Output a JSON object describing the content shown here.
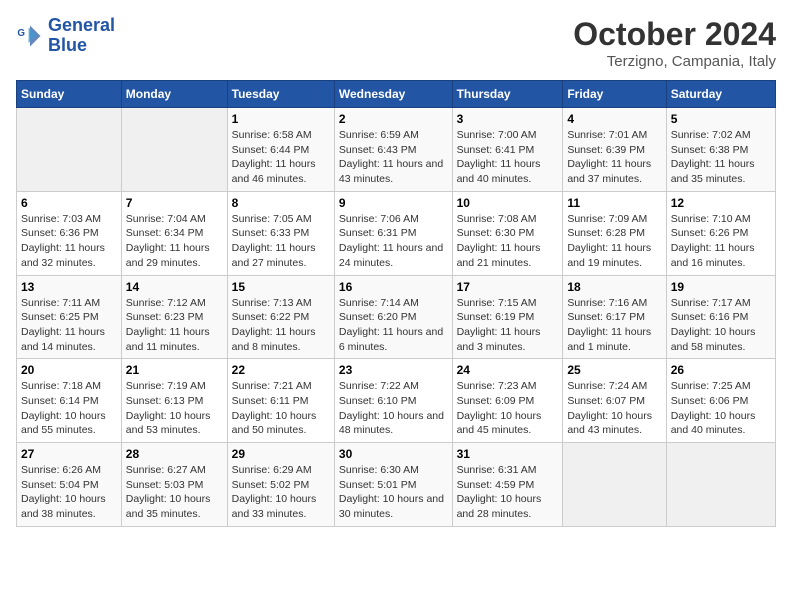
{
  "logo": {
    "line1": "General",
    "line2": "Blue"
  },
  "title": "October 2024",
  "location": "Terzigno, Campania, Italy",
  "weekdays": [
    "Sunday",
    "Monday",
    "Tuesday",
    "Wednesday",
    "Thursday",
    "Friday",
    "Saturday"
  ],
  "weeks": [
    [
      {
        "day": "",
        "info": ""
      },
      {
        "day": "",
        "info": ""
      },
      {
        "day": "1",
        "info": "Sunrise: 6:58 AM\nSunset: 6:44 PM\nDaylight: 11 hours and 46 minutes."
      },
      {
        "day": "2",
        "info": "Sunrise: 6:59 AM\nSunset: 6:43 PM\nDaylight: 11 hours and 43 minutes."
      },
      {
        "day": "3",
        "info": "Sunrise: 7:00 AM\nSunset: 6:41 PM\nDaylight: 11 hours and 40 minutes."
      },
      {
        "day": "4",
        "info": "Sunrise: 7:01 AM\nSunset: 6:39 PM\nDaylight: 11 hours and 37 minutes."
      },
      {
        "day": "5",
        "info": "Sunrise: 7:02 AM\nSunset: 6:38 PM\nDaylight: 11 hours and 35 minutes."
      }
    ],
    [
      {
        "day": "6",
        "info": "Sunrise: 7:03 AM\nSunset: 6:36 PM\nDaylight: 11 hours and 32 minutes."
      },
      {
        "day": "7",
        "info": "Sunrise: 7:04 AM\nSunset: 6:34 PM\nDaylight: 11 hours and 29 minutes."
      },
      {
        "day": "8",
        "info": "Sunrise: 7:05 AM\nSunset: 6:33 PM\nDaylight: 11 hours and 27 minutes."
      },
      {
        "day": "9",
        "info": "Sunrise: 7:06 AM\nSunset: 6:31 PM\nDaylight: 11 hours and 24 minutes."
      },
      {
        "day": "10",
        "info": "Sunrise: 7:08 AM\nSunset: 6:30 PM\nDaylight: 11 hours and 21 minutes."
      },
      {
        "day": "11",
        "info": "Sunrise: 7:09 AM\nSunset: 6:28 PM\nDaylight: 11 hours and 19 minutes."
      },
      {
        "day": "12",
        "info": "Sunrise: 7:10 AM\nSunset: 6:26 PM\nDaylight: 11 hours and 16 minutes."
      }
    ],
    [
      {
        "day": "13",
        "info": "Sunrise: 7:11 AM\nSunset: 6:25 PM\nDaylight: 11 hours and 14 minutes."
      },
      {
        "day": "14",
        "info": "Sunrise: 7:12 AM\nSunset: 6:23 PM\nDaylight: 11 hours and 11 minutes."
      },
      {
        "day": "15",
        "info": "Sunrise: 7:13 AM\nSunset: 6:22 PM\nDaylight: 11 hours and 8 minutes."
      },
      {
        "day": "16",
        "info": "Sunrise: 7:14 AM\nSunset: 6:20 PM\nDaylight: 11 hours and 6 minutes."
      },
      {
        "day": "17",
        "info": "Sunrise: 7:15 AM\nSunset: 6:19 PM\nDaylight: 11 hours and 3 minutes."
      },
      {
        "day": "18",
        "info": "Sunrise: 7:16 AM\nSunset: 6:17 PM\nDaylight: 11 hours and 1 minute."
      },
      {
        "day": "19",
        "info": "Sunrise: 7:17 AM\nSunset: 6:16 PM\nDaylight: 10 hours and 58 minutes."
      }
    ],
    [
      {
        "day": "20",
        "info": "Sunrise: 7:18 AM\nSunset: 6:14 PM\nDaylight: 10 hours and 55 minutes."
      },
      {
        "day": "21",
        "info": "Sunrise: 7:19 AM\nSunset: 6:13 PM\nDaylight: 10 hours and 53 minutes."
      },
      {
        "day": "22",
        "info": "Sunrise: 7:21 AM\nSunset: 6:11 PM\nDaylight: 10 hours and 50 minutes."
      },
      {
        "day": "23",
        "info": "Sunrise: 7:22 AM\nSunset: 6:10 PM\nDaylight: 10 hours and 48 minutes."
      },
      {
        "day": "24",
        "info": "Sunrise: 7:23 AM\nSunset: 6:09 PM\nDaylight: 10 hours and 45 minutes."
      },
      {
        "day": "25",
        "info": "Sunrise: 7:24 AM\nSunset: 6:07 PM\nDaylight: 10 hours and 43 minutes."
      },
      {
        "day": "26",
        "info": "Sunrise: 7:25 AM\nSunset: 6:06 PM\nDaylight: 10 hours and 40 minutes."
      }
    ],
    [
      {
        "day": "27",
        "info": "Sunrise: 6:26 AM\nSunset: 5:04 PM\nDaylight: 10 hours and 38 minutes."
      },
      {
        "day": "28",
        "info": "Sunrise: 6:27 AM\nSunset: 5:03 PM\nDaylight: 10 hours and 35 minutes."
      },
      {
        "day": "29",
        "info": "Sunrise: 6:29 AM\nSunset: 5:02 PM\nDaylight: 10 hours and 33 minutes."
      },
      {
        "day": "30",
        "info": "Sunrise: 6:30 AM\nSunset: 5:01 PM\nDaylight: 10 hours and 30 minutes."
      },
      {
        "day": "31",
        "info": "Sunrise: 6:31 AM\nSunset: 4:59 PM\nDaylight: 10 hours and 28 minutes."
      },
      {
        "day": "",
        "info": ""
      },
      {
        "day": "",
        "info": ""
      }
    ]
  ]
}
